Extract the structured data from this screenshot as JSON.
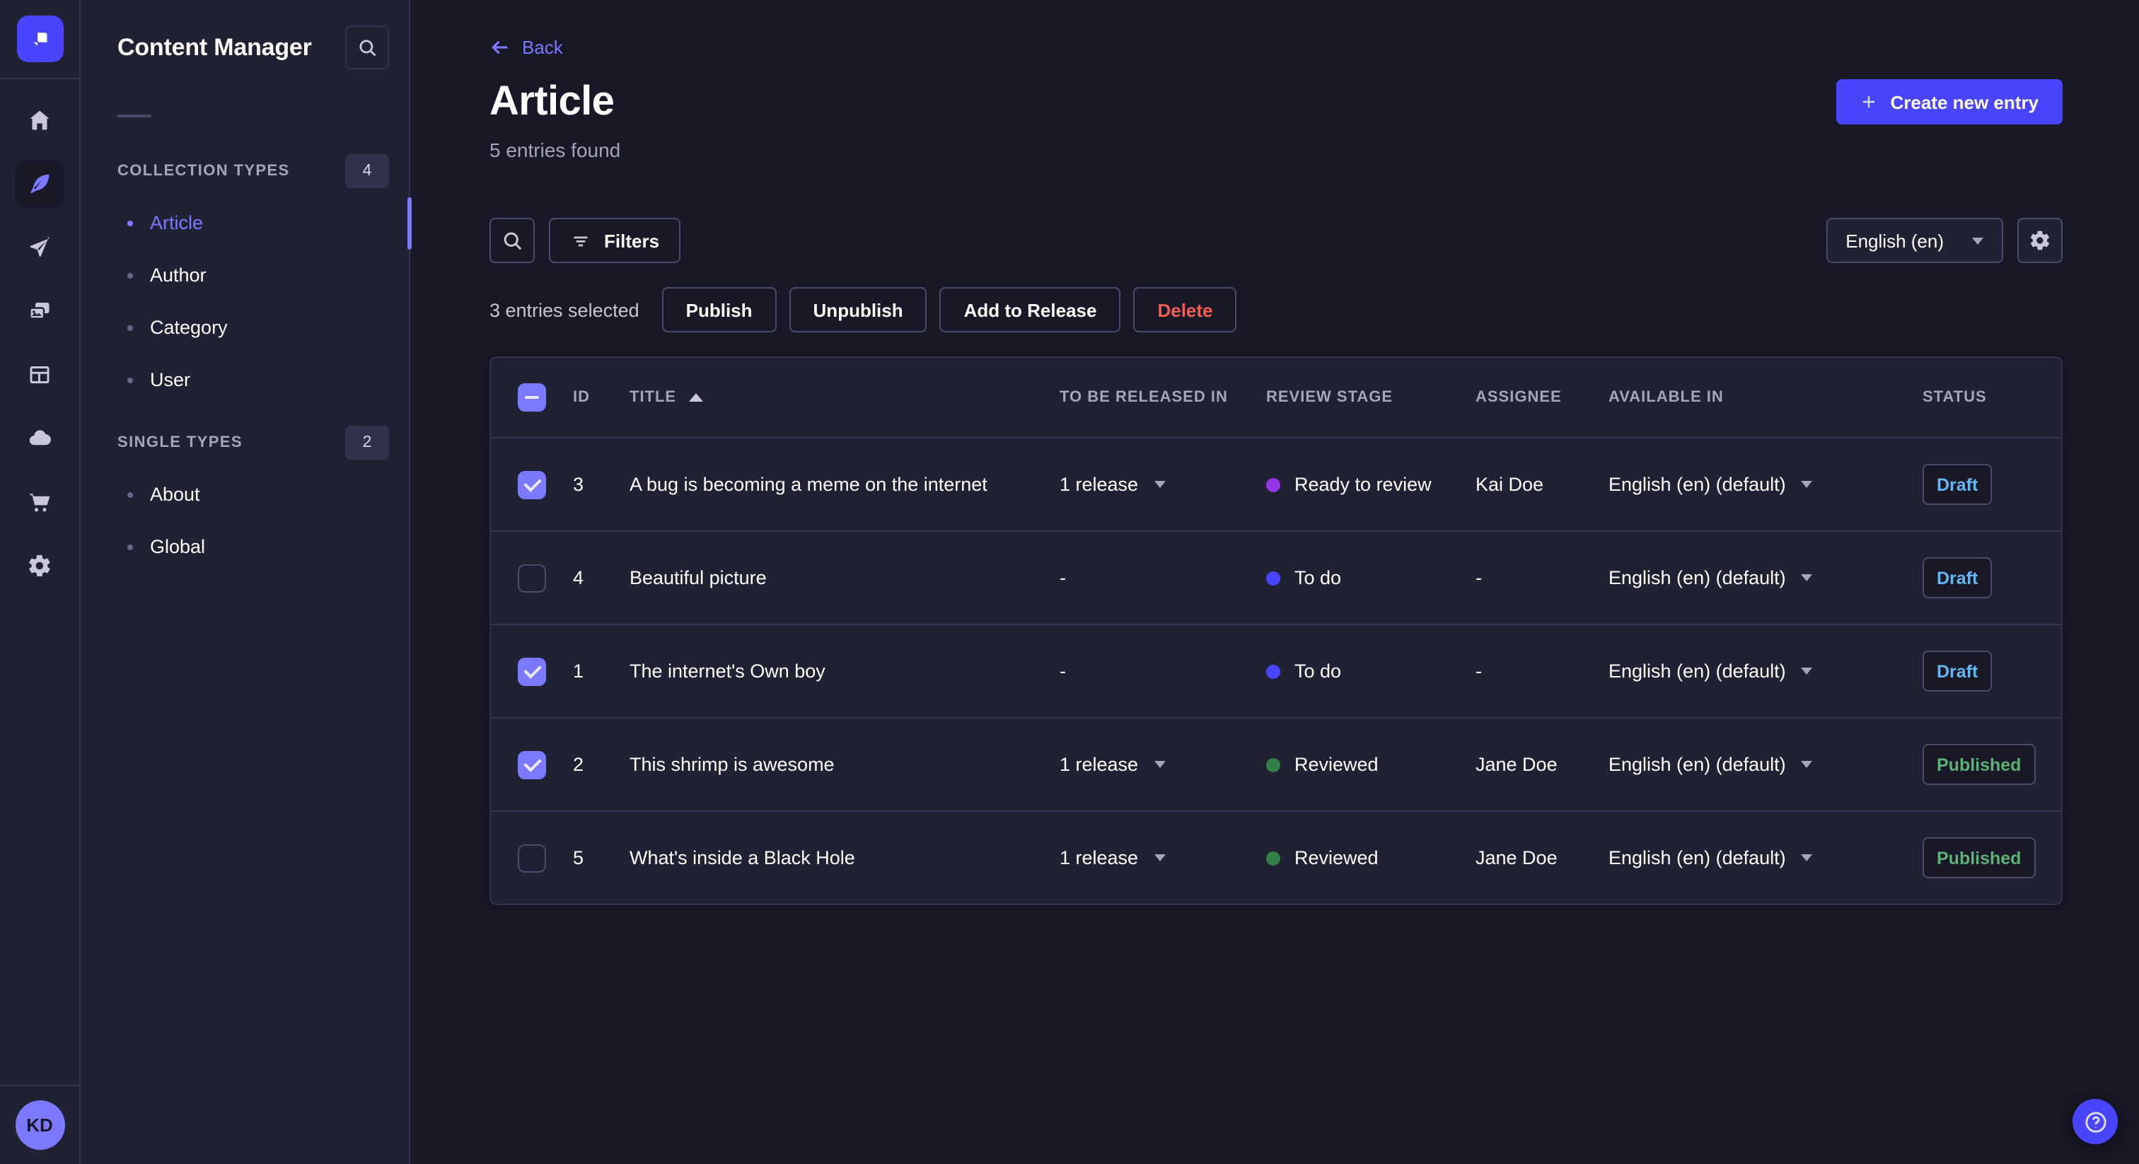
{
  "colors": {
    "page_bg": "#181826",
    "surface": "#212134",
    "border": "#32324d",
    "border_strong": "#4a4a6a",
    "text": "#ffffff",
    "text_muted": "#a5a5ba",
    "icon": "#c8c8d8",
    "primary": "#4945ff",
    "primary_light": "#7b79ff",
    "danger": "#ee5e52",
    "success": "#5cb176",
    "draft": "#66b7f1"
  },
  "rail": {
    "logo_icon": "strapi-logo",
    "items": [
      {
        "icon": "home-icon",
        "active": false
      },
      {
        "icon": "content-manager-feather-icon",
        "active": true
      },
      {
        "icon": "send-icon",
        "active": false
      },
      {
        "icon": "media-library-icon",
        "active": false
      },
      {
        "icon": "content-type-builder-icon",
        "active": false
      },
      {
        "icon": "cloud-icon",
        "active": false
      },
      {
        "icon": "marketplace-cart-icon",
        "active": false
      },
      {
        "icon": "settings-gear-icon",
        "active": false
      }
    ],
    "avatar_initials": "KD"
  },
  "sidebar": {
    "title": "Content Manager",
    "search_icon": "search-icon",
    "sections": [
      {
        "label": "COLLECTION TYPES",
        "badge": "4",
        "items": [
          {
            "label": "Article",
            "active": true
          },
          {
            "label": "Author",
            "active": false
          },
          {
            "label": "Category",
            "active": false
          },
          {
            "label": "User",
            "active": false
          }
        ]
      },
      {
        "label": "SINGLE TYPES",
        "badge": "2",
        "items": [
          {
            "label": "About",
            "active": false
          },
          {
            "label": "Global",
            "active": false
          }
        ]
      }
    ]
  },
  "header": {
    "back_label": "Back",
    "title": "Article",
    "subtitle": "5 entries found",
    "create_label": "Create new entry"
  },
  "toolbar": {
    "search_icon": "search-icon",
    "filters_label": "Filters",
    "filters_icon": "filter-icon",
    "locale_selected": "English (en)",
    "settings_icon": "gear-icon"
  },
  "selection": {
    "text": "3 entries selected",
    "publish_label": "Publish",
    "unpublish_label": "Unpublish",
    "add_to_release_label": "Add to Release",
    "delete_label": "Delete"
  },
  "table": {
    "select_all_state": "indeterminate",
    "sort_column": "TITLE",
    "sort_direction": "asc",
    "columns": [
      "ID",
      "TITLE",
      "TO BE RELEASED IN",
      "REVIEW STAGE",
      "ASSIGNEE",
      "AVAILABLE IN",
      "STATUS"
    ],
    "rows": [
      {
        "checked": true,
        "id": "3",
        "title": "A bug is becoming a meme on the internet",
        "release": "1 release",
        "release_menu": true,
        "stage": "Ready to review",
        "stage_color": "#9736e8",
        "assignee": "Kai Doe",
        "locale": "English (en) (default)",
        "status": "Draft"
      },
      {
        "checked": false,
        "id": "4",
        "title": "Beautiful picture",
        "release": "-",
        "release_menu": false,
        "stage": "To do",
        "stage_color": "#4945ff",
        "assignee": "-",
        "locale": "English (en) (default)",
        "status": "Draft"
      },
      {
        "checked": true,
        "id": "1",
        "title": "The internet's Own boy",
        "release": "-",
        "release_menu": false,
        "stage": "To do",
        "stage_color": "#4945ff",
        "assignee": "-",
        "locale": "English (en) (default)",
        "status": "Draft"
      },
      {
        "checked": true,
        "id": "2",
        "title": "This shrimp is awesome",
        "release": "1 release",
        "release_menu": true,
        "stage": "Reviewed",
        "stage_color": "#328048",
        "assignee": "Jane Doe",
        "locale": "English (en) (default)",
        "status": "Published"
      },
      {
        "checked": false,
        "id": "5",
        "title": "What's inside a Black Hole",
        "release": "1 release",
        "release_menu": true,
        "stage": "Reviewed",
        "stage_color": "#328048",
        "assignee": "Jane Doe",
        "locale": "English (en) (default)",
        "status": "Published"
      }
    ]
  },
  "help": {
    "icon": "help-icon"
  }
}
